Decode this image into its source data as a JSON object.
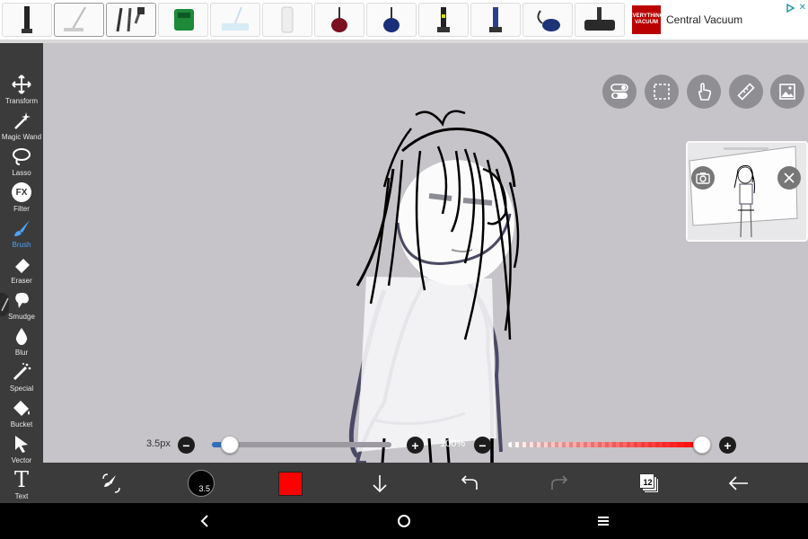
{
  "ad": {
    "products": [
      "vacuum-1",
      "mop",
      "stick-vacuums",
      "carpet-cleaner",
      "steam-mop",
      "central-unit",
      "canister-red",
      "canister-blue",
      "upright-black",
      "upright-blue",
      "canister-navy",
      "power-head"
    ],
    "logo_text": "EVERYTHING VACUUM",
    "advertiser": "Central Vacuum"
  },
  "toolbar": {
    "tools": [
      {
        "id": "transform",
        "label": "Transform",
        "icon": "move-icon"
      },
      {
        "id": "magic-wand",
        "label": "Magic Wand",
        "icon": "magic-wand-icon"
      },
      {
        "id": "lasso",
        "label": "Lasso",
        "icon": "lasso-icon"
      },
      {
        "id": "filter",
        "label": "Filter",
        "icon": "fx-icon",
        "glyph": "FX"
      },
      {
        "id": "brush",
        "label": "Brush",
        "icon": "brush-icon",
        "active": true
      },
      {
        "id": "eraser",
        "label": "Eraser",
        "icon": "eraser-icon"
      },
      {
        "id": "smudge",
        "label": "Smudge",
        "icon": "smudge-icon"
      },
      {
        "id": "blur",
        "label": "Blur",
        "icon": "drop-icon"
      },
      {
        "id": "special",
        "label": "Special",
        "icon": "special-pen-icon"
      },
      {
        "id": "bucket",
        "label": "Bucket",
        "icon": "bucket-icon"
      },
      {
        "id": "vector",
        "label": "Vector",
        "icon": "cursor-icon"
      },
      {
        "id": "text",
        "label": "Text",
        "icon": "text-icon",
        "glyph": "T"
      }
    ]
  },
  "quick_buttons": [
    "toggle-icon",
    "selection-icon",
    "hand-icon",
    "ruler-icon",
    "image-icon"
  ],
  "brush": {
    "size_label": "3.5px",
    "size_level": 0.06,
    "opacity_label": "100%",
    "opacity_level": 1.0,
    "size_badge": "3.5",
    "color": "#ff0000",
    "accent": "#2f6fbf"
  },
  "layers": {
    "count": "12"
  },
  "colors": {
    "canvas": "#c6c4c8",
    "toolbar": "#3b3b3b",
    "active_tool": "#4da3ff"
  }
}
